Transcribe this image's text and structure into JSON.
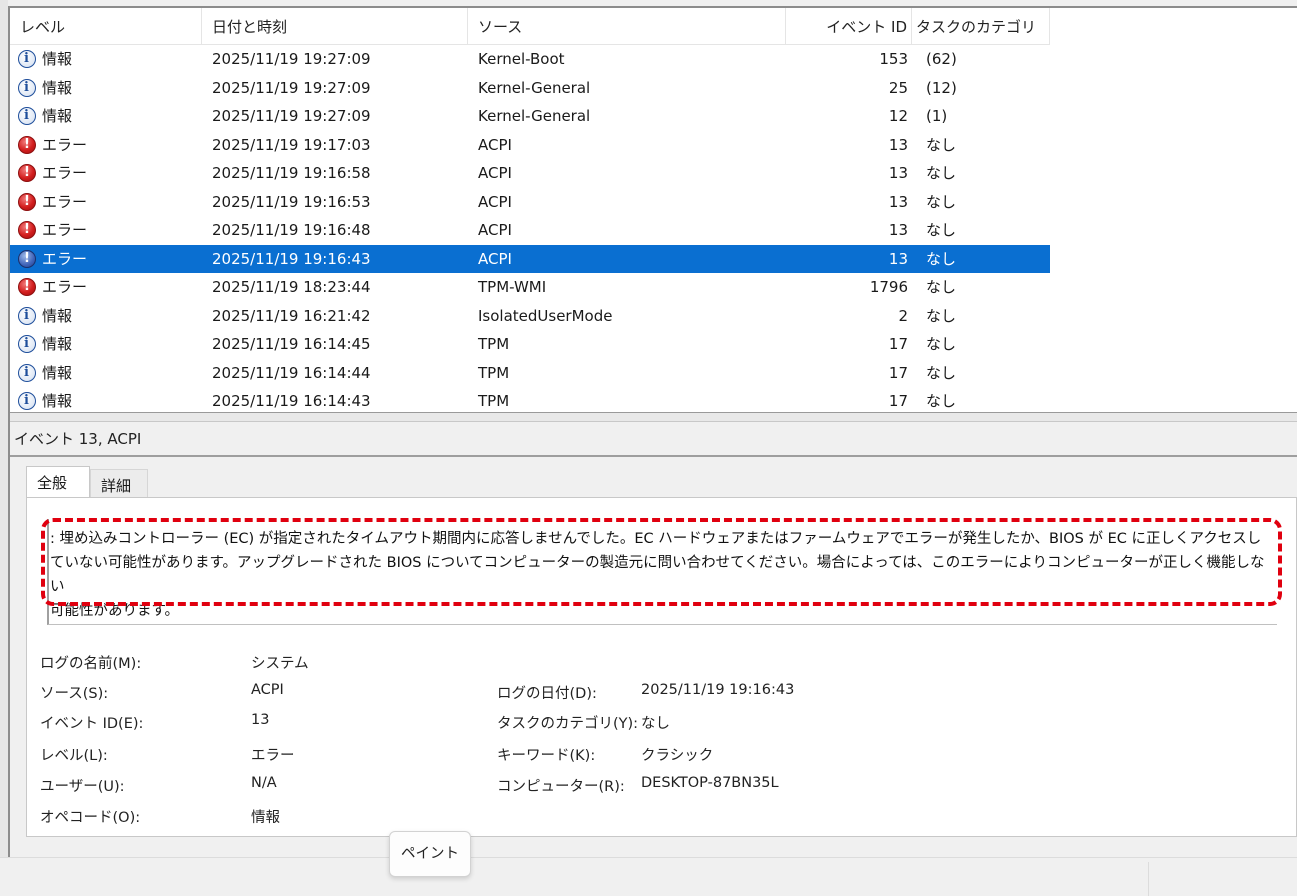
{
  "colors": {
    "selection": "#0a6fd1",
    "highlight_border": "#e0000f",
    "error_icon": "#d31e1e",
    "info_icon": "#1e4e9b"
  },
  "list": {
    "columns": [
      "レベル",
      "日付と時刻",
      "ソース",
      "イベント ID",
      "タスクのカテゴリ"
    ],
    "rows": [
      {
        "icon": "info-icon",
        "level": "情報",
        "datetime": "2025/11/19 19:27:09",
        "source": "Kernel-Boot",
        "id": "153",
        "category": "(62)"
      },
      {
        "icon": "info-icon",
        "level": "情報",
        "datetime": "2025/11/19 19:27:09",
        "source": "Kernel-General",
        "id": "25",
        "category": "(12)"
      },
      {
        "icon": "info-icon",
        "level": "情報",
        "datetime": "2025/11/19 19:27:09",
        "source": "Kernel-General",
        "id": "12",
        "category": "(1)"
      },
      {
        "icon": "error-icon",
        "level": "エラー",
        "datetime": "2025/11/19 19:17:03",
        "source": "ACPI",
        "id": "13",
        "category": "なし"
      },
      {
        "icon": "error-icon",
        "level": "エラー",
        "datetime": "2025/11/19 19:16:58",
        "source": "ACPI",
        "id": "13",
        "category": "なし"
      },
      {
        "icon": "error-icon",
        "level": "エラー",
        "datetime": "2025/11/19 19:16:53",
        "source": "ACPI",
        "id": "13",
        "category": "なし"
      },
      {
        "icon": "error-icon",
        "level": "エラー",
        "datetime": "2025/11/19 19:16:48",
        "source": "ACPI",
        "id": "13",
        "category": "なし"
      },
      {
        "icon": "error-icon",
        "level": "エラー",
        "datetime": "2025/11/19 19:16:43",
        "source": "ACPI",
        "id": "13",
        "category": "なし"
      },
      {
        "icon": "error-icon",
        "level": "エラー",
        "datetime": "2025/11/19 18:23:44",
        "source": "TPM-WMI",
        "id": "1796",
        "category": "なし"
      },
      {
        "icon": "info-icon",
        "level": "情報",
        "datetime": "2025/11/19 16:21:42",
        "source": "IsolatedUserMode",
        "id": "2",
        "category": "なし"
      },
      {
        "icon": "info-icon",
        "level": "情報",
        "datetime": "2025/11/19 16:14:45",
        "source": "TPM",
        "id": "17",
        "category": "なし"
      },
      {
        "icon": "info-icon",
        "level": "情報",
        "datetime": "2025/11/19 16:14:44",
        "source": "TPM",
        "id": "17",
        "category": "なし"
      },
      {
        "icon": "info-icon",
        "level": "情報",
        "datetime": "2025/11/19 16:14:43",
        "source": "TPM",
        "id": "17",
        "category": "なし"
      }
    ],
    "selected_index": 7
  },
  "detail": {
    "title": "イベント 13, ACPI",
    "tabs": [
      "全般",
      "詳細"
    ],
    "description_lines": [
      ": 埋め込みコントローラー (EC) が指定されたタイムアウト期間内に応答しませんでした。EC ハードウェアまたはファームウェアでエラーが発生したか、BIOS が EC に正しくアクセスし",
      "ていない可能性があります。アップグレードされた BIOS についてコンピューターの製造元に問い合わせてください。場合によっては、このエラーによりコンピューターが正しく機能しない",
      "可能性があります。"
    ],
    "fields": {
      "log_name_label": "ログの名前(M):",
      "log_name": "システム",
      "source_label": "ソース(S):",
      "source": "ACPI",
      "event_id_label": "イベント ID(E):",
      "event_id": "13",
      "level_label": "レベル(L):",
      "level": "エラー",
      "user_label": "ユーザー(U):",
      "user": "N/A",
      "opcode_label": "オペコード(O):",
      "opcode": "情報",
      "logged_label": "ログの日付(D):",
      "logged": "2025/11/19 19:16:43",
      "task_label": "タスクのカテゴリ(Y):",
      "task": "なし",
      "keywords_label": "キーワード(K):",
      "keywords": "クラシック",
      "computer_label": "コンピューター(R):",
      "computer": "DESKTOP-87BN35L"
    }
  },
  "tooltip": "ペイント"
}
